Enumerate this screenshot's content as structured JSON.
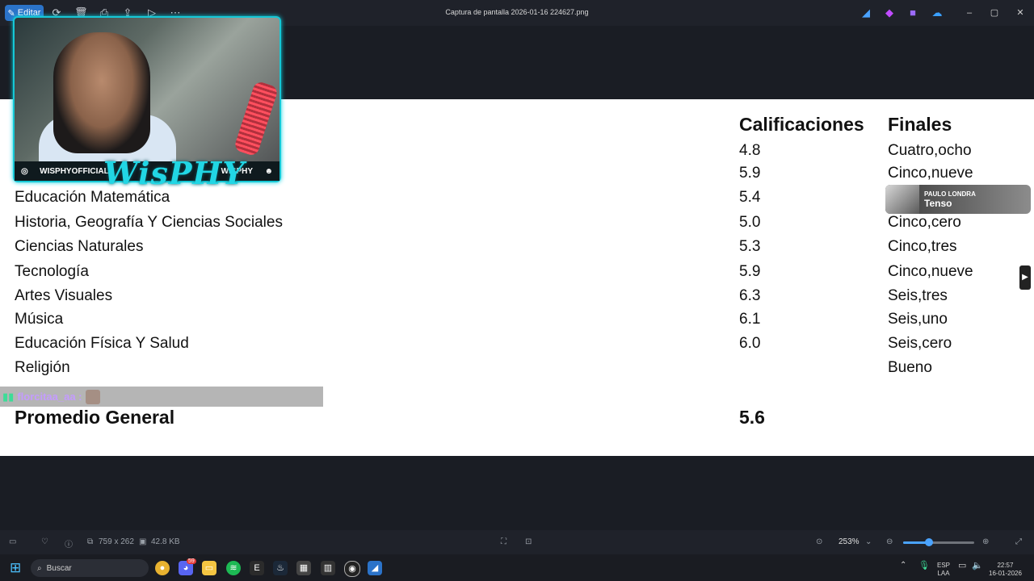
{
  "window": {
    "title": "Captura de pantalla 2026-01-16 224627.png",
    "edit_label": "Editar"
  },
  "document": {
    "header_grades": "Calificaciones",
    "header_finals": "Finales",
    "rows": [
      {
        "subject": "",
        "grade": "4.8",
        "final": "Cuatro,ocho"
      },
      {
        "subject": "",
        "grade": "5.9",
        "final": "Cinco,nueve"
      },
      {
        "subject": "Educación Matemática",
        "grade": "5.4",
        "final": ""
      },
      {
        "subject": "Historia, Geografía Y Ciencias Sociales",
        "grade": "5.0",
        "final": "Cinco,cero"
      },
      {
        "subject": "Ciencias Naturales",
        "grade": "5.3",
        "final": "Cinco,tres"
      },
      {
        "subject": "Tecnología",
        "grade": "5.9",
        "final": "Cinco,nueve"
      },
      {
        "subject": "Artes Visuales",
        "grade": "6.3",
        "final": "Seis,tres"
      },
      {
        "subject": "Música",
        "grade": "6.1",
        "final": "Seis,uno"
      },
      {
        "subject": "Educación Física Y Salud",
        "grade": "6.0",
        "final": "Seis,cero"
      },
      {
        "subject": "Religión",
        "grade": "",
        "final": "Bueno"
      }
    ],
    "total_label": "Promedio General",
    "total_value": "5.6"
  },
  "stream": {
    "left_handle": "WISPHYOFFICIAL",
    "right_handle": "WISPHY",
    "logo": "WisPHY",
    "chat_user": "florcitaa_aa :"
  },
  "music": {
    "artist": "PAULO LONDRA",
    "song": "Tenso"
  },
  "status": {
    "dimensions": "759 x 262",
    "filesize": "42.8 KB",
    "zoom": "253%",
    "zoom_fraction": 0.36
  },
  "taskbar": {
    "search_placeholder": "Buscar",
    "lang_top": "ESP",
    "lang_bottom": "LAA",
    "time": "22:57",
    "date": "16-01-2026",
    "discord_badge": "59"
  },
  "colors": {
    "accent": "#2b73c9",
    "stream_cyan": "#16c8d6"
  }
}
